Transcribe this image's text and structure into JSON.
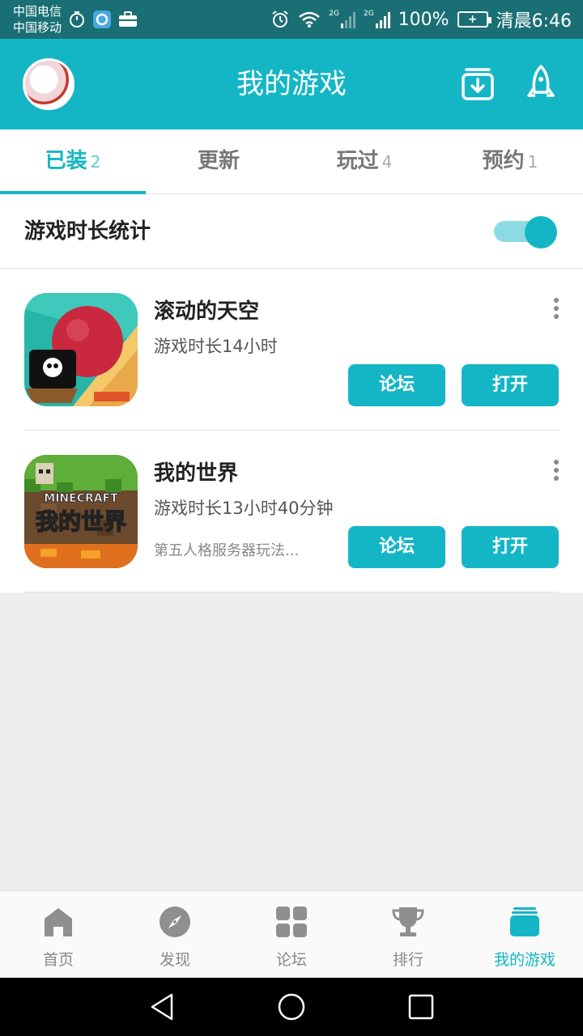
{
  "status_bar": {
    "carrier1": "中国电信",
    "carrier2": "中国移动",
    "net1": "2G",
    "net2": "2G",
    "battery": "100%",
    "time": "清晨6:46"
  },
  "header": {
    "title": "我的游戏"
  },
  "tabs": [
    {
      "label": "已装",
      "count": "2"
    },
    {
      "label": "更新",
      "count": ""
    },
    {
      "label": "玩过",
      "count": "4"
    },
    {
      "label": "预约",
      "count": "1"
    }
  ],
  "stats": {
    "label": "游戏时长统计",
    "toggle_on": true
  },
  "games": [
    {
      "name": "滚动的天空",
      "playtime": "游戏时长14小时",
      "note": "",
      "forum_label": "论坛",
      "open_label": "打开"
    },
    {
      "name": "我的世界",
      "playtime": "游戏时长13小时40分钟",
      "note": "第五人格服务器玩法...",
      "forum_label": "论坛",
      "open_label": "打开",
      "icon_text": "我的世界",
      "icon_subtext": "MINECRAFT"
    }
  ],
  "bottom_nav": [
    {
      "label": "首页",
      "icon": "home-icon"
    },
    {
      "label": "发现",
      "icon": "compass-icon"
    },
    {
      "label": "论坛",
      "icon": "grid-icon"
    },
    {
      "label": "排行",
      "icon": "trophy-icon"
    },
    {
      "label": "我的游戏",
      "icon": "games-stack-icon",
      "active": true
    }
  ],
  "colors": {
    "accent": "#14b6c6",
    "statusbar": "#1a6f75"
  }
}
